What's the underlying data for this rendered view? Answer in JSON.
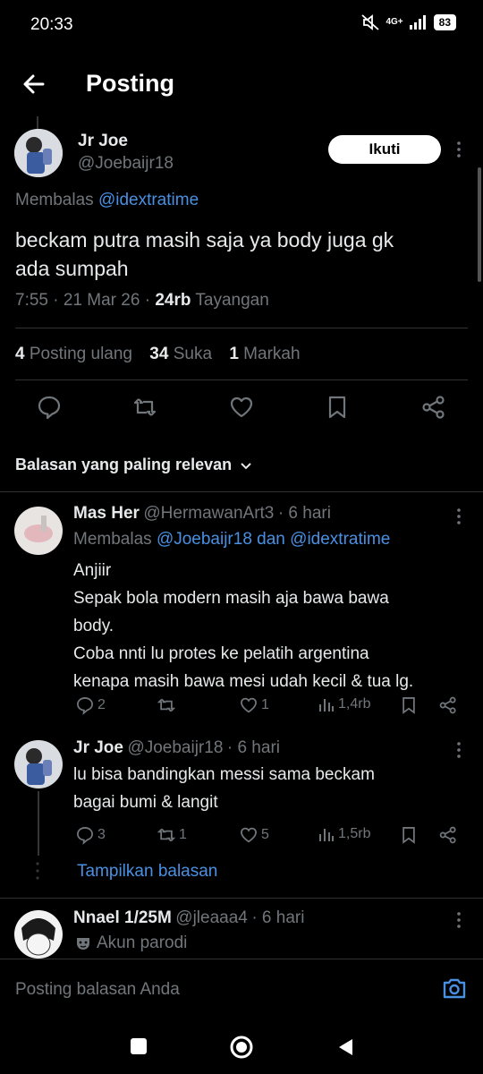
{
  "status": {
    "time": "20:33",
    "network": "4G+",
    "battery": "83"
  },
  "header": {
    "title": "Posting"
  },
  "post": {
    "name": "Jr Joe",
    "handle": "@Joebaijr18",
    "follow_label": "Ikuti",
    "replying_prefix": "Membalas",
    "replying_to": "@idextratime",
    "text_line1": "beckam putra masih saja ya body juga gk",
    "text_line2": "ada sumpah",
    "time": "7:55 · 21 Mar 26 ·",
    "views_count": "24rb",
    "views_label": "Tayangan",
    "reposts_count": "4",
    "reposts_label": "Posting ulang",
    "likes_count": "34",
    "likes_label": "Suka",
    "bookmarks_count": "1",
    "bookmarks_label": "Markah"
  },
  "sort_label": "Balasan yang paling relevan",
  "replies": [
    {
      "name": "Mas Her",
      "handle": "@HermawanArt3",
      "age": "· 6 hari",
      "replying_prefix": "Membalas",
      "replying_to": "@Joebaijr18 dan @idextratime",
      "lines": [
        "Anjiir",
        "Sepak bola modern masih aja bawa bawa",
        "body.",
        "Coba nnti lu protes ke pelatih argentina",
        "kenapa masih bawa mesi udah kecil & tua lg."
      ],
      "replies": "2",
      "reposts": "",
      "likes": "1",
      "views": "1,4rb"
    },
    {
      "name": "Jr Joe",
      "handle": "@Joebaijr18",
      "age": "· 6 hari",
      "lines": [
        "lu bisa bandingkan messi sama beckam",
        "bagai bumi & langit"
      ],
      "replies": "3",
      "reposts": "1",
      "likes": "5",
      "views": "1,5rb"
    },
    {
      "name": "Nnael 1/25M",
      "handle": "@jleaaa4",
      "age": "· 6 hari",
      "badge": "Akun parodi"
    }
  ],
  "show_replies_label": "Tampilkan balasan",
  "compose_placeholder": "Posting balasan Anda",
  "colors": {
    "accent": "#4a90e2",
    "background": "#000000",
    "muted": "#71767b"
  }
}
